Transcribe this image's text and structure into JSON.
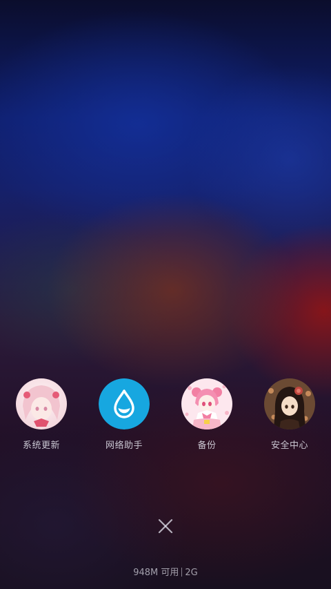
{
  "apps": [
    {
      "label": "系统更新",
      "icon": "anime-avatar-pink-hair-icon"
    },
    {
      "label": "网络助手",
      "icon": "water-drop-icon",
      "color": "#17a7e0"
    },
    {
      "label": "备份",
      "icon": "anime-avatar-magical-girl-icon"
    },
    {
      "label": "安全中心",
      "icon": "anime-avatar-dark-hair-icon"
    }
  ],
  "close": {
    "icon": "close-icon"
  },
  "memory": {
    "available": "948M 可用",
    "total": "2G"
  }
}
